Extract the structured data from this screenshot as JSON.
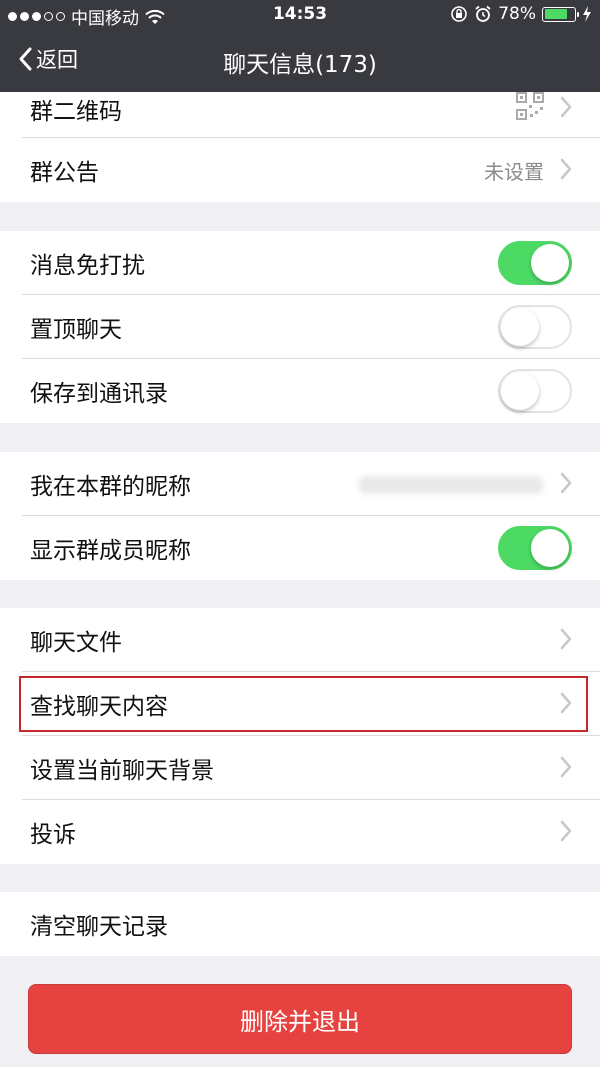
{
  "status_bar": {
    "carrier": "中国移动",
    "time": "14:53",
    "battery_percent": "78%",
    "battery_level": 0.78,
    "icons": [
      "signal-dots-icon",
      "wifi-icon",
      "rotation-lock-icon",
      "alarm-icon",
      "battery-icon",
      "charging-icon"
    ]
  },
  "nav": {
    "back_label": "返回",
    "title": "聊天信息(173)"
  },
  "section1": {
    "qr_label": "群二维码",
    "notice_label": "群公告",
    "notice_value": "未设置"
  },
  "section2": {
    "mute_label": "消息免打扰",
    "mute_on": true,
    "pin_label": "置顶聊天",
    "pin_on": false,
    "save_label": "保存到通讯录",
    "save_on": false
  },
  "section3": {
    "nickname_label": "我在本群的昵称",
    "show_names_label": "显示群成员昵称",
    "show_names_on": true
  },
  "section4": {
    "files_label": "聊天文件",
    "search_label": "查找聊天内容",
    "background_label": "设置当前聊天背景",
    "report_label": "投诉"
  },
  "section5": {
    "clear_label": "清空聊天记录"
  },
  "delete_button": "删除并退出",
  "colors": {
    "nav_background": "#393a3f",
    "toggle_on": "#4cd964",
    "delete_button": "#e64340",
    "highlight_box": "#c6262e"
  }
}
